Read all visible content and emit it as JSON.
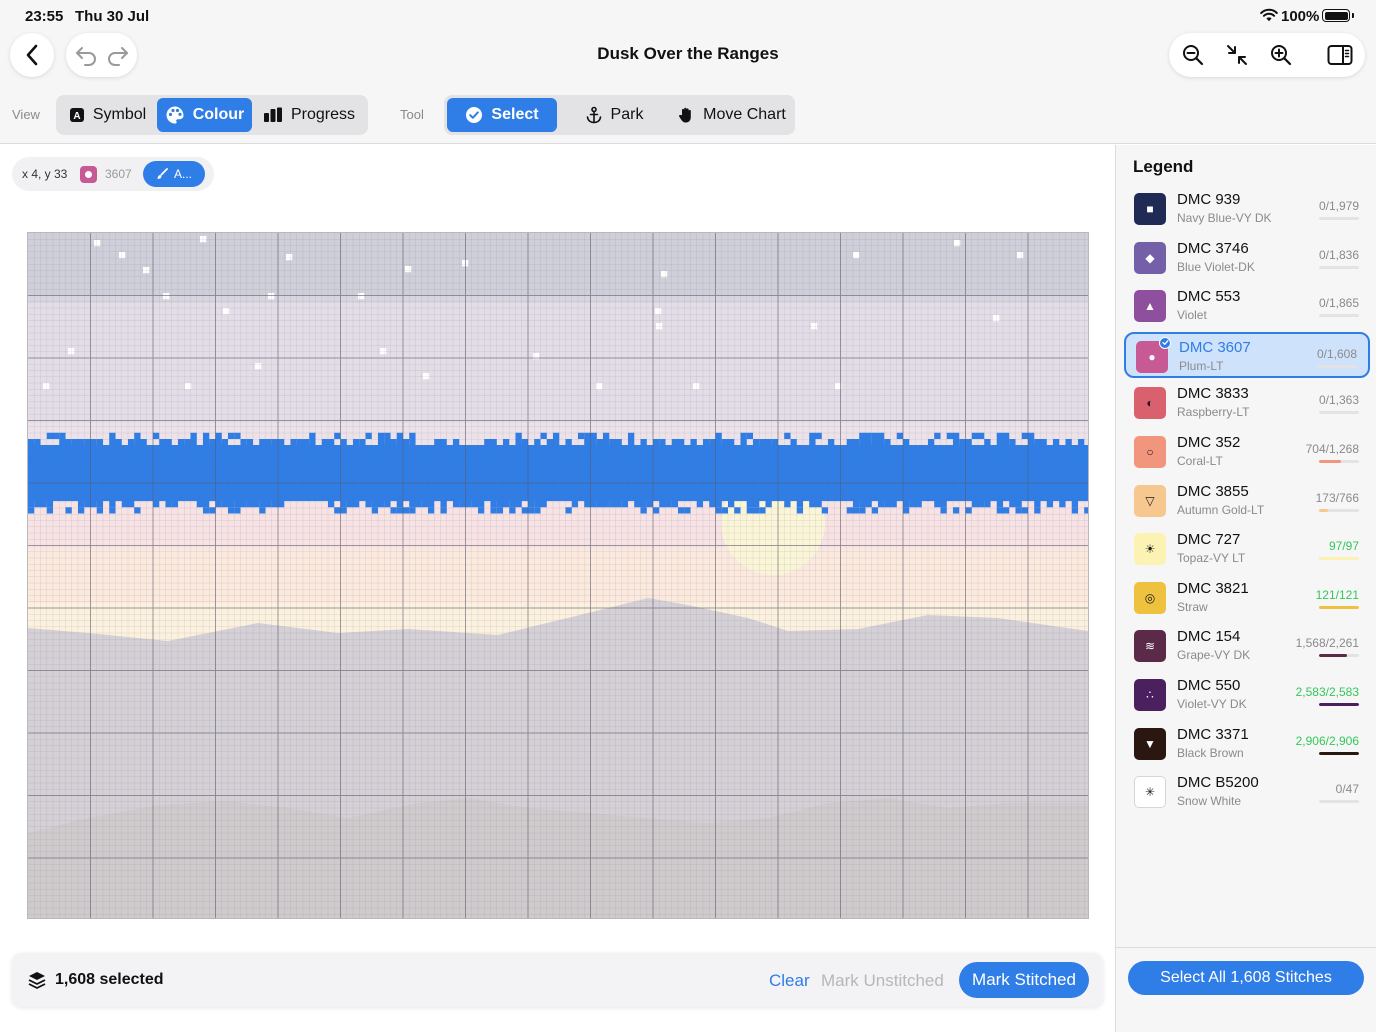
{
  "status_bar": {
    "time": "23:55",
    "date": "Thu 30 Jul",
    "battery": "100%"
  },
  "header": {
    "title": "Dusk Over the Ranges"
  },
  "view_group": {
    "label": "View",
    "options": [
      {
        "label": "Symbol",
        "active": false,
        "icon": "symbol-icon"
      },
      {
        "label": "Colour",
        "active": true,
        "icon": "palette-icon"
      },
      {
        "label": "Progress",
        "active": false,
        "icon": "progress-bars-icon"
      }
    ]
  },
  "tool_group": {
    "label": "Tool",
    "options": [
      {
        "label": "Select",
        "active": true,
        "icon": "checkmark-circle-icon"
      },
      {
        "label": "Park",
        "active": false,
        "icon": "anchor-icon"
      },
      {
        "label": "Move Chart",
        "active": false,
        "icon": "hand-icon"
      }
    ]
  },
  "info_pill": {
    "coords": "x 4, y 33",
    "code": "3607",
    "action_label": "A..."
  },
  "selection_bar": {
    "count_label": "1,608 selected",
    "clear_label": "Clear",
    "mark_unstitched_label": "Mark Unstitched",
    "mark_stitched_label": "Mark Stitched"
  },
  "legend": {
    "title": "Legend",
    "select_all_label": "Select All 1,608 Stitches",
    "items": [
      {
        "code": "DMC 939",
        "name": "Navy Blue-VY DK",
        "count": "0/1,979",
        "color": "#1f2a55",
        "symbol": "■",
        "symbol_color": "#ffffff",
        "progress": 0,
        "complete": false,
        "selected": false
      },
      {
        "code": "DMC 3746",
        "name": "Blue Violet-DK",
        "count": "0/1,836",
        "color": "#7460a8",
        "symbol": "◆",
        "symbol_color": "#ffffff",
        "progress": 0,
        "complete": false,
        "selected": false
      },
      {
        "code": "DMC 553",
        "name": "Violet",
        "count": "0/1,865",
        "color": "#8e4f9e",
        "symbol": "▲",
        "symbol_color": "#ffffff",
        "progress": 0,
        "complete": false,
        "selected": false
      },
      {
        "code": "DMC 3607",
        "name": "Plum-LT",
        "count": "0/1,608",
        "color": "#c75a95",
        "symbol": "●",
        "symbol_color": "#ffffff",
        "progress": 0,
        "complete": false,
        "selected": true
      },
      {
        "code": "DMC 3833",
        "name": "Raspberry-LT",
        "count": "0/1,363",
        "color": "#d9616e",
        "symbol": "◐",
        "symbol_color": "#1a1a1a",
        "progress": 0,
        "complete": false,
        "selected": false
      },
      {
        "code": "DMC 352",
        "name": "Coral-LT",
        "count": "704/1,268",
        "color": "#f2957d",
        "symbol": "○",
        "symbol_color": "#1a1a1a",
        "progress": 0.555,
        "complete": false,
        "selected": false
      },
      {
        "code": "DMC 3855",
        "name": "Autumn Gold-LT",
        "count": "173/766",
        "color": "#f6c88f",
        "symbol": "▽",
        "symbol_color": "#1a1a1a",
        "progress": 0.226,
        "complete": false,
        "selected": false
      },
      {
        "code": "DMC 727",
        "name": "Topaz-VY LT",
        "count": "97/97",
        "color": "#fbf2b3",
        "symbol": "☀",
        "symbol_color": "#1a1a1a",
        "progress": 1.0,
        "complete": true,
        "selected": false
      },
      {
        "code": "DMC 3821",
        "name": "Straw",
        "count": "121/121",
        "color": "#eec23f",
        "symbol": "◎",
        "symbol_color": "#1a1a1a",
        "progress": 1.0,
        "complete": true,
        "selected": false
      },
      {
        "code": "DMC 154",
        "name": "Grape-VY DK",
        "count": "1,568/2,261",
        "color": "#5a2a48",
        "symbol": "≋",
        "symbol_color": "#ffffff",
        "progress": 0.694,
        "complete": false,
        "selected": false
      },
      {
        "code": "DMC 550",
        "name": "Violet-VY DK",
        "count": "2,583/2,583",
        "color": "#4b205f",
        "symbol": "∴",
        "symbol_color": "#ffffff",
        "progress": 1.0,
        "complete": true,
        "selected": false
      },
      {
        "code": "DMC 3371",
        "name": "Black Brown",
        "count": "2,906/2,906",
        "color": "#2a170f",
        "symbol": "▼",
        "symbol_color": "#ffffff",
        "progress": 1.0,
        "complete": true,
        "selected": false
      },
      {
        "code": "DMC B5200",
        "name": "Snow White",
        "count": "0/47",
        "color": "#ffffff",
        "symbol": "✳",
        "symbol_color": "#1a1a1a",
        "progress": 0,
        "complete": false,
        "selected": false
      }
    ]
  },
  "colors": {
    "accent": "#2f7de6",
    "complete_text": "#34c759",
    "sky_top": "#cfcfd9",
    "sky_mid": "#e3dde7",
    "sky_low": "#ece2ea",
    "horizon_pink": "#f7e2e4",
    "glow": "#fbe9de",
    "cream": "#fbf1de",
    "mountain_far": "#d5d0d6",
    "mountain_near": "#d1cdd1",
    "sun": "#fbf5d8",
    "selection": "#2f7de6",
    "star": "#ffffff"
  }
}
